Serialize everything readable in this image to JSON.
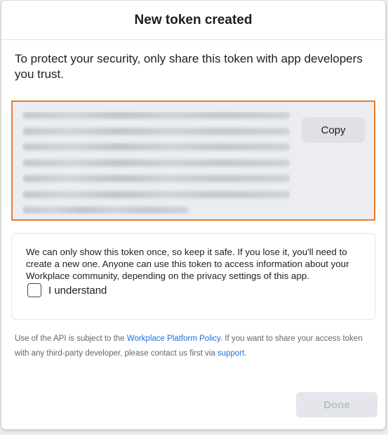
{
  "dialog": {
    "title": "New token created",
    "intro": "To protect your security, only share this token with app developers you trust.",
    "token": {
      "obscured": true,
      "line_count": 7,
      "copy_label": "Copy",
      "highlight_color": "#f07a26"
    },
    "warning": {
      "text": "We can only show this token once, so keep it safe. If you lose it, you'll need to create a new one. Anyone can use this token to access information about your Workplace community, depending on the privacy settings of this app.",
      "checkbox_label": "I understand",
      "checked": false
    },
    "policy": {
      "part1": "Use of the API is subject to the ",
      "link1": "Workplace Platform Policy",
      "part2": ". If you want to share your access token with any third-party developer, please contact us first via ",
      "link2": "support",
      "part3": "."
    },
    "done_label": "Done",
    "done_enabled": false
  }
}
